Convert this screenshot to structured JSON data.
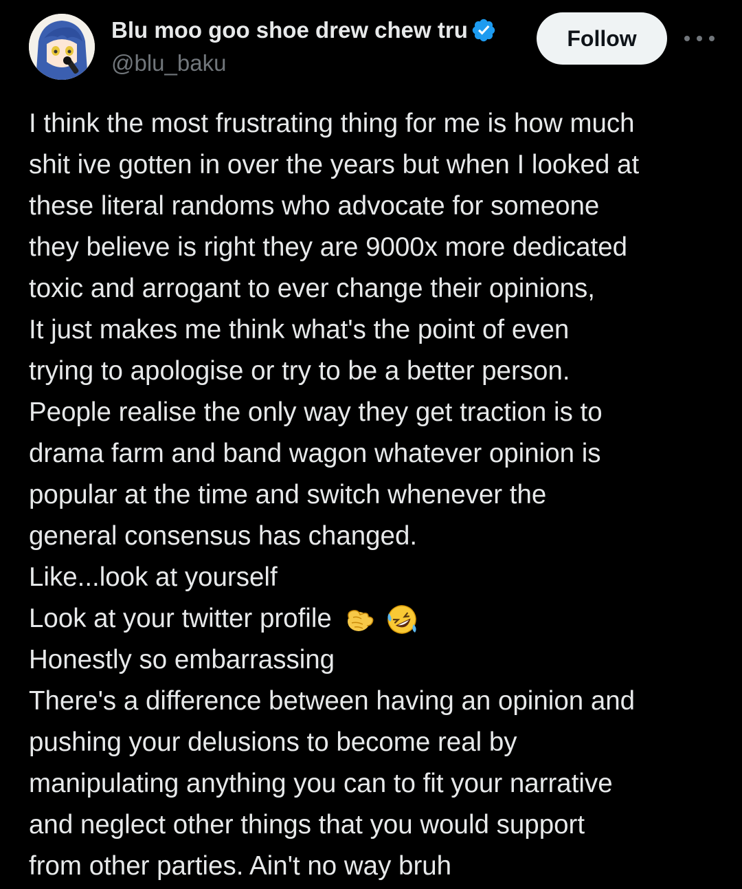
{
  "author": {
    "display_name": "Blu moo goo shoe drew chew tru",
    "handle": "@blu_baku",
    "verified": true,
    "avatar_icon": "anime-avatar-icon"
  },
  "actions": {
    "follow_label": "Follow",
    "more_icon": "more-options-icon"
  },
  "colors": {
    "background": "#000000",
    "text": "#e7e9ea",
    "secondary_text": "#71767b",
    "verified": "#1d9bf0",
    "follow_bg": "#eff3f4"
  },
  "tweet": {
    "lines": [
      "I think the most frustrating thing for me is how much",
      "shit ive gotten in over the years but when I looked at",
      "these literal randoms who advocate for someone",
      "they believe is right they are 9000x more dedicated",
      "toxic and arrogant to ever change their opinions,",
      "It just makes me think what's the point of even",
      "trying to apologise or try to be a better person.",
      "People realise the only way they get traction is to",
      "drama farm and band wagon whatever opinion is",
      "popular at the time and switch whenever the",
      "general consensus has changed.",
      "Like...look at yourself",
      "Look at your twitter profile",
      "Honestly so embarrassing",
      "There's a difference between having an opinion and",
      "pushing your delusions to become real by",
      "manipulating anything you can to fit your narrative",
      "and neglect other things that you would support",
      "from other parties. Ain't no way bruh"
    ],
    "emojis": [
      "pointing-hand-emoji",
      "rolling-laughing-emoji"
    ]
  }
}
